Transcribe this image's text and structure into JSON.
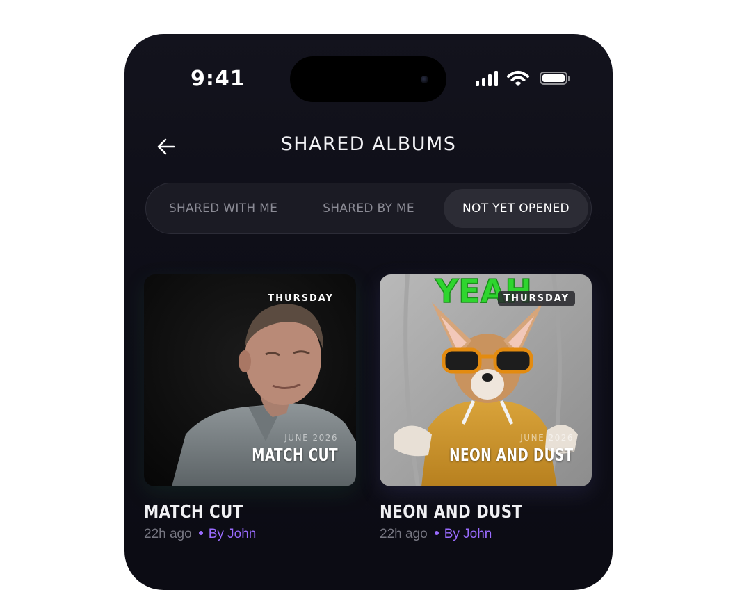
{
  "status_bar": {
    "time": "9:41"
  },
  "header": {
    "title": "SHARED ALBUMS"
  },
  "tabs": [
    {
      "label": "SHARED WITH ME",
      "selected": false
    },
    {
      "label": "SHARED BY ME",
      "selected": false
    },
    {
      "label": "NOT YET OPENED",
      "selected": true
    }
  ],
  "albums": [
    {
      "day": "THURSDAY",
      "date": "JUNE 2026",
      "cover_title": "MATCH CUT",
      "title": "MATCH CUT",
      "time_ago": "22h ago",
      "author": "By John"
    },
    {
      "day": "THURSDAY",
      "date": "JUNE 2026",
      "cover_title": "NEON AND DUST",
      "cover_caption": "YEAH",
      "title": "NEON AND DUST",
      "time_ago": "22h ago",
      "author": "By John"
    }
  ],
  "colors": {
    "background": "#0e0e17",
    "accent": "#9a6bff",
    "tab_selected_bg": "#2c2c35"
  }
}
